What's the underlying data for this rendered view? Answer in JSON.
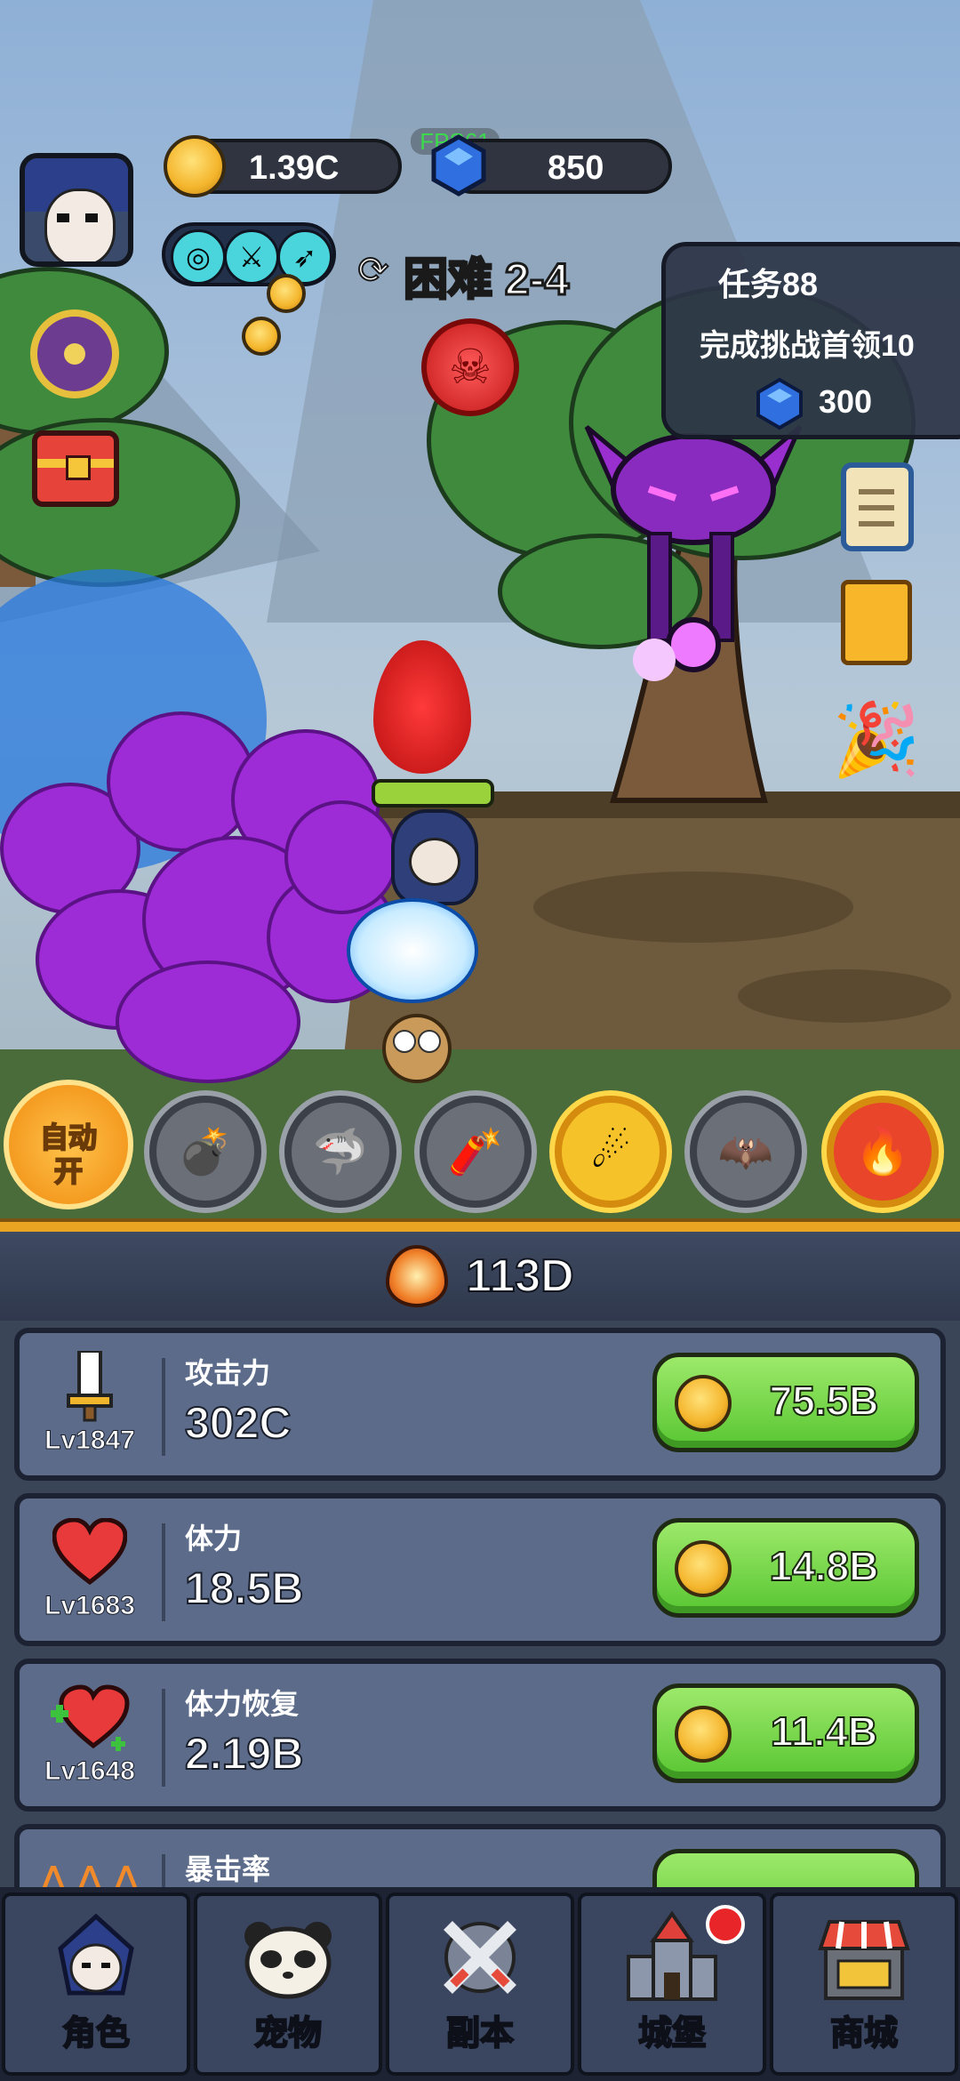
{
  "hud": {
    "fps": "FPS61",
    "gold": "1.39C",
    "gems": "850",
    "difficulty": "困难 2-4"
  },
  "quest": {
    "title": "任务88",
    "desc": "完成挑战首领10",
    "reward": "300"
  },
  "auto_button": {
    "line1": "自动",
    "line2": "开"
  },
  "dps": "113D",
  "stats": [
    {
      "name": "攻击力",
      "level": "Lv1847",
      "value": "302C",
      "cost": "75.5B",
      "icon": "sword-icon"
    },
    {
      "name": "体力",
      "level": "Lv1683",
      "value": "18.5B",
      "cost": "14.8B",
      "icon": "heart-icon"
    },
    {
      "name": "体力恢复",
      "level": "Lv1648",
      "value": "2.19B",
      "cost": "11.4B",
      "icon": "heart-plus-icon"
    },
    {
      "name": "暴击率",
      "level": "",
      "value": "",
      "cost": "",
      "icon": "claw-icon"
    }
  ],
  "nav": [
    {
      "label": "角色",
      "icon": "hero-icon"
    },
    {
      "label": "宠物",
      "icon": "panda-icon"
    },
    {
      "label": "副本",
      "icon": "crossed-swords-icon"
    },
    {
      "label": "城堡",
      "icon": "castle-icon"
    },
    {
      "label": "商城",
      "icon": "shop-icon"
    }
  ],
  "colors": {
    "panel": "#5c6b89",
    "buy_green": "#58c632",
    "gold": "#f4b52c",
    "gem": "#2f6fe0"
  }
}
